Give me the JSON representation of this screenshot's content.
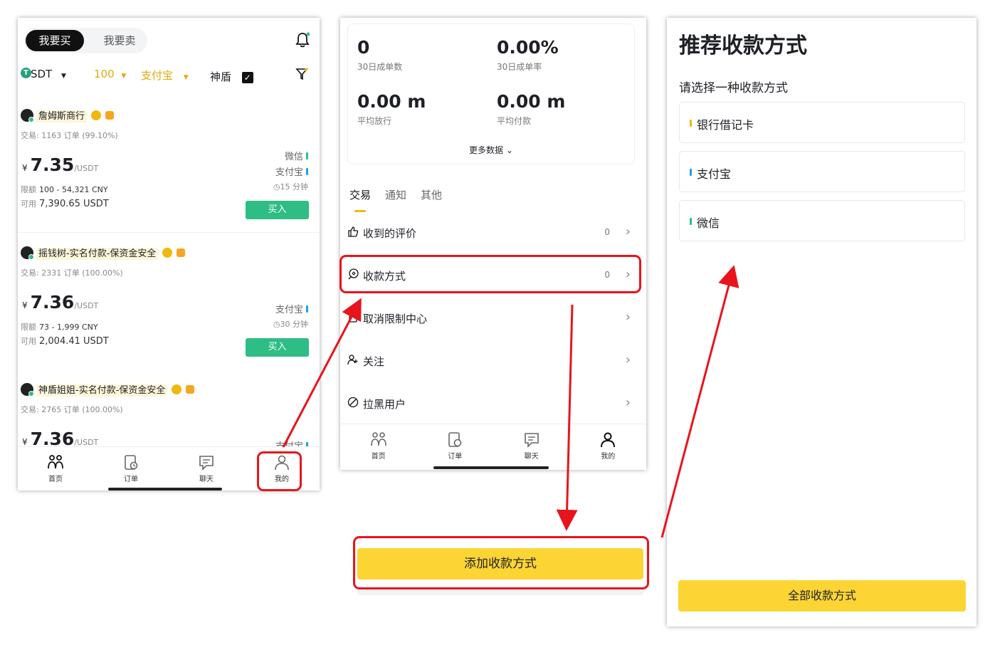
{
  "panel1": {
    "tab_buy": "我要买",
    "tab_sell": "我要卖",
    "coin": "USDT",
    "coin_icon": "T",
    "amount_filter": "100",
    "payment_filter": "支付宝",
    "shield_label": "神盾",
    "ads": [
      {
        "name": "詹姆斯商行",
        "trade_label": "交易",
        "trade": "1163 订单 (99.10%)",
        "currency": "¥",
        "price": "7.35",
        "unit": "/USDT",
        "limit_label": "限额",
        "limit": "100 - 54,321 CNY",
        "avail_label": "可用",
        "avail": "7,390.65 USDT",
        "payments": [
          "微信",
          "支付宝"
        ],
        "time": "15 分钟",
        "buy": "买入"
      },
      {
        "name": "摇钱树-实名付款-保资金安全",
        "trade_label": "交易",
        "trade": "2331 订单 (100.00%)",
        "currency": "¥",
        "price": "7.36",
        "unit": "/USDT",
        "limit_label": "限额",
        "limit": "73 - 1,999 CNY",
        "avail_label": "可用",
        "avail": "2,004.41 USDT",
        "payments": [
          "支付宝"
        ],
        "time": "30 分钟",
        "buy": "买入"
      },
      {
        "name": "神盾姐姐-实名付款-保资金安全",
        "trade_label": "交易",
        "trade": "2765 订单 (100.00%)",
        "currency": "¥",
        "price": "7.36",
        "unit": "/USDT",
        "payments": [
          "支付宝"
        ]
      }
    ],
    "nav": [
      "首页",
      "订单",
      "聊天",
      "我的"
    ]
  },
  "panel2": {
    "stats": [
      {
        "value": "0",
        "label": "30日成单数"
      },
      {
        "value": "0.00%",
        "label": "30日成单率"
      },
      {
        "value": "0.00 m",
        "label": "平均放行"
      },
      {
        "value": "0.00 m",
        "label": "平均付款"
      }
    ],
    "more": "更多数据",
    "tabs": [
      "交易",
      "通知",
      "其他"
    ],
    "rows": [
      {
        "label": "收到的评价",
        "count": "0"
      },
      {
        "label": "收款方式",
        "count": "0"
      },
      {
        "label": "取消限制中心",
        "count": ""
      },
      {
        "label": "关注",
        "count": ""
      },
      {
        "label": "拉黑用户",
        "count": ""
      }
    ],
    "nav": [
      "首页",
      "订单",
      "聊天",
      "我的"
    ]
  },
  "add_button": "添加收款方式",
  "panel3": {
    "title": "推荐收款方式",
    "subtitle": "请选择一种收款方式",
    "options": [
      {
        "label": "银行借记卡",
        "color": "#f0b90b"
      },
      {
        "label": "支付宝",
        "color": "#1e9fe8"
      },
      {
        "label": "微信",
        "color": "#2ebd85"
      }
    ],
    "all_button": "全部收款方式"
  },
  "colors": {
    "accent_yellow": "#fcd535",
    "buy_green": "#2ebd85",
    "annotation_red": "#e8141c"
  }
}
